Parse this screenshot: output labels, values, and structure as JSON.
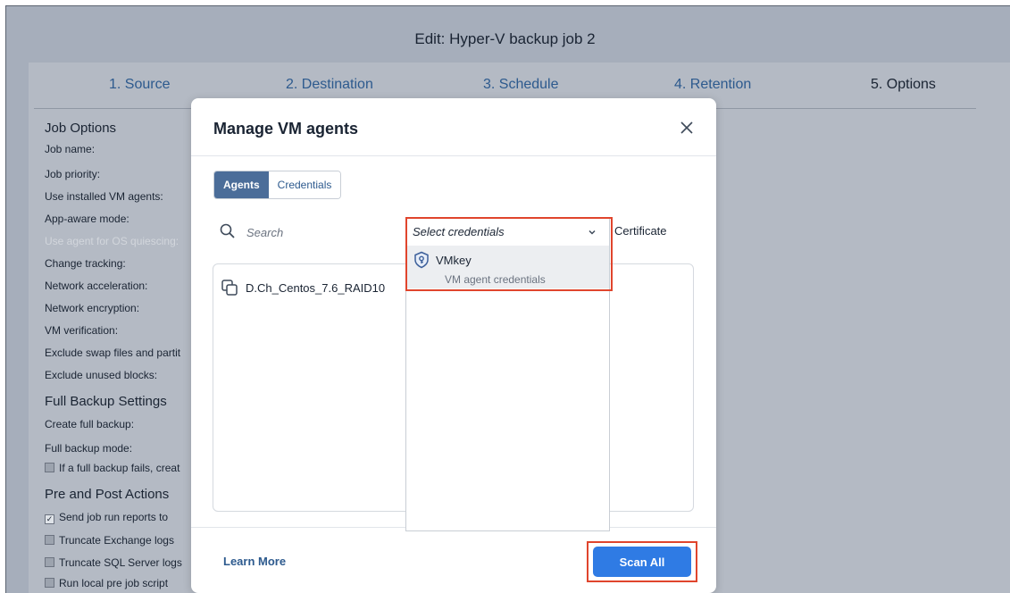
{
  "window": {
    "title": "Edit: Hyper-V backup job 2"
  },
  "wizard": {
    "steps": [
      {
        "label": "1. Source"
      },
      {
        "label": "2. Destination"
      },
      {
        "label": "3. Schedule"
      },
      {
        "label": "4. Retention"
      },
      {
        "label": "5. Options",
        "active": true
      }
    ]
  },
  "options_panel": {
    "job_options_heading": "Job Options",
    "job_name": "Job name:",
    "job_priority": "Job priority:",
    "use_installed_vm_agents": "Use installed VM agents:",
    "app_aware_mode": "App-aware mode:",
    "use_agent_for_os_quiescing": "Use agent for OS quiescing:",
    "change_tracking": "Change tracking:",
    "network_acceleration": "Network acceleration:",
    "network_encryption": "Network encryption:",
    "vm_verification": "VM verification:",
    "exclude_swap": "Exclude swap files and partit",
    "exclude_unused": "Exclude unused blocks:",
    "full_backup_heading": "Full Backup Settings",
    "create_full_backup": "Create full backup:",
    "full_backup_mode": "Full backup mode:",
    "if_full_backup_fails": "If a full backup fails, creat",
    "pre_post_heading": "Pre and Post Actions",
    "send_job_reports": "Send job run reports to",
    "truncate_exchange": "Truncate Exchange logs",
    "truncate_sql": "Truncate SQL Server logs",
    "run_local_pre": "Run local pre job script"
  },
  "modal": {
    "title": "Manage VM agents",
    "tabs": {
      "agents": "Agents",
      "credentials": "Credentials"
    },
    "search_placeholder": "Search",
    "certificate_header": "Certificate",
    "agents": [
      {
        "name": "D.Ch_Centos_7.6_RAID10"
      }
    ],
    "credentials_dropdown": {
      "placeholder": "Select credentials",
      "options": [
        {
          "name": "VMkey",
          "description": "VM agent credentials"
        }
      ]
    },
    "learn_more": "Learn More",
    "scan_all": "Scan All"
  },
  "colors": {
    "accent": "#2f7be4",
    "highlight": "#e0452d",
    "overlay": "#a6aebb"
  }
}
